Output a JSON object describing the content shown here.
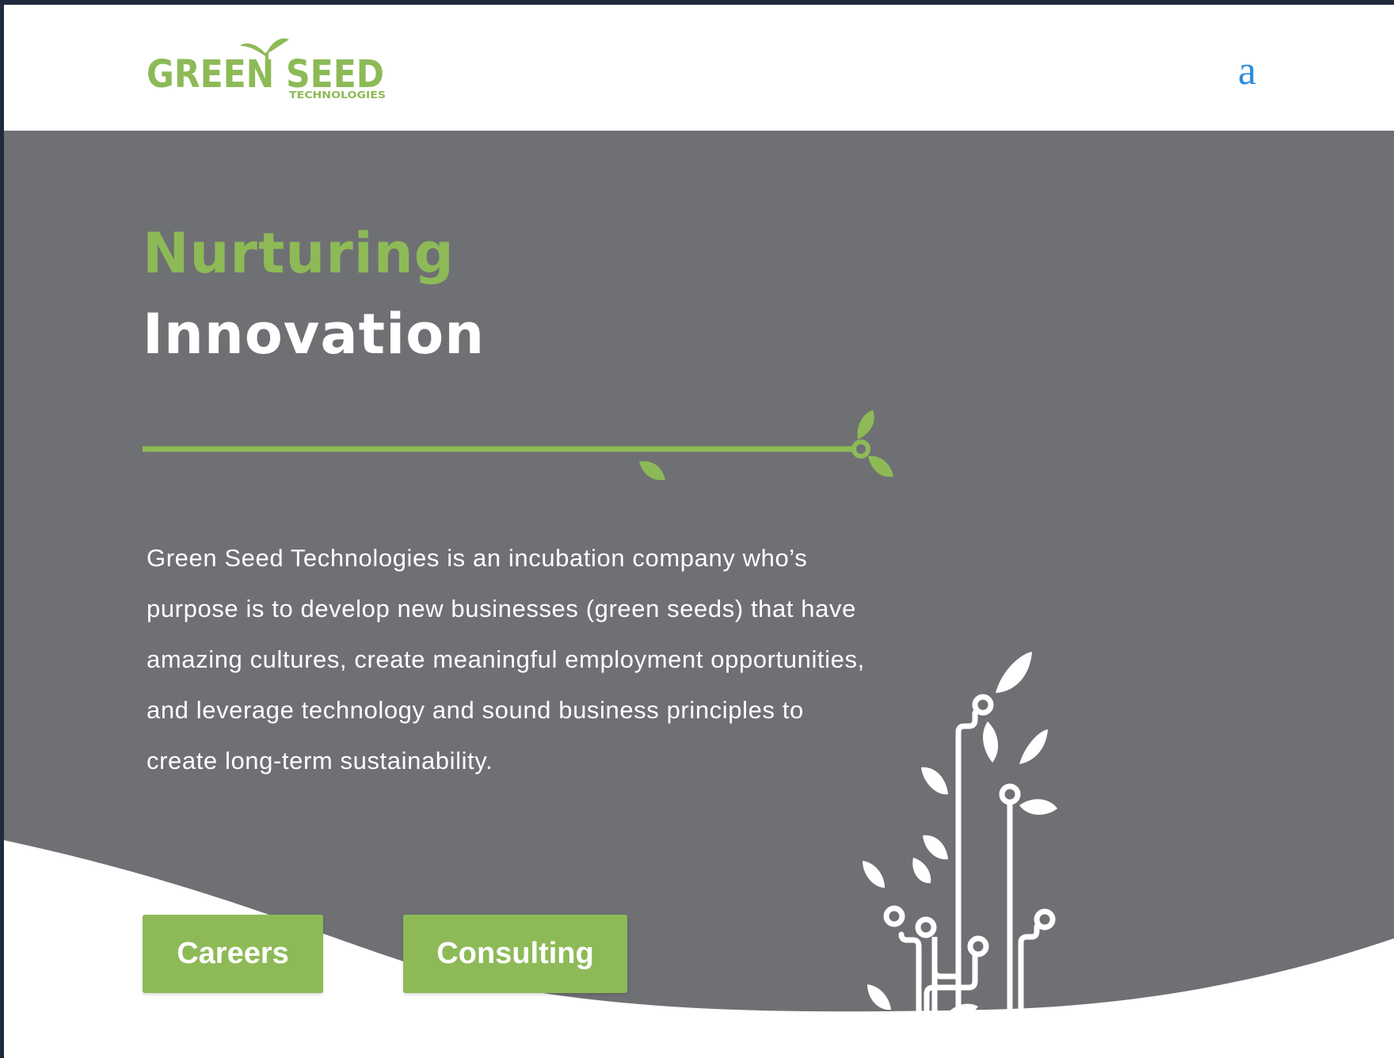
{
  "header": {
    "logo": {
      "wordmark": "GREEN SEED",
      "subtitle": "TECHNOLOGIES",
      "icon": "sprout-logo-icon"
    },
    "menu_glyph": "a"
  },
  "hero": {
    "headline_line1": "Nurturing",
    "headline_line2": "Innovation",
    "description": "Green Seed Technologies is an incubation company who’s purpose is to develop new businesses (green seeds) that have amazing cultures, create meaningful employment opportunities, and leverage technology and sound business principles to create long-term sustainability.",
    "buttons": {
      "careers": "Careers",
      "consulting": "Consulting"
    }
  },
  "colors": {
    "brand_green": "#8dba57",
    "hero_gray": "#6f7074",
    "menu_blue": "#2d8cdb",
    "white": "#ffffff"
  },
  "icons": {
    "divider": "sprout-vine-divider-icon",
    "illustration": "circuit-plant-illustration-icon"
  }
}
